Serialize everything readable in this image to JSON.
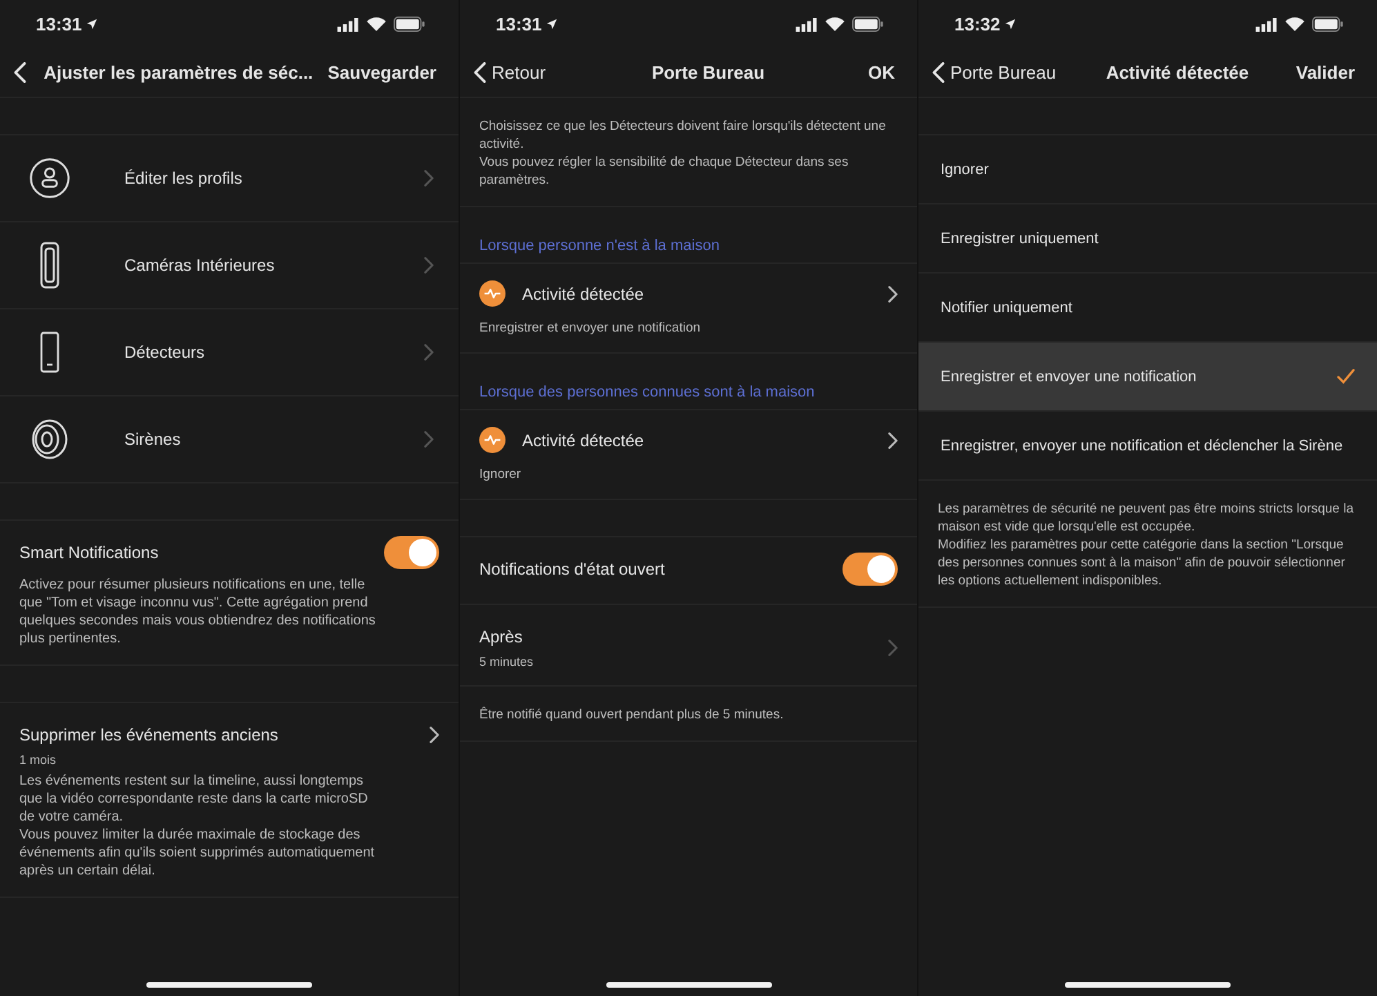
{
  "screens": [
    {
      "status_bar": {
        "time": "13:31"
      },
      "nav": {
        "title": "Ajuster les paramètres de séc...",
        "action": "Sauvegarder"
      },
      "blocks": [
        {
          "kind": "spacer"
        },
        {
          "kind": "menu",
          "items": [
            {
              "label": "Éditer les profils"
            },
            {
              "label": "Caméras Intérieures"
            },
            {
              "label": "Détecteurs"
            },
            {
              "label": "Sirènes"
            }
          ]
        },
        {
          "kind": "spacer"
        },
        {
          "kind": "toggle",
          "title": "Smart Notifications",
          "on": true,
          "description": "Activez pour résumer plusieurs notifications en une, telle que \"Tom et visage inconnu vus\". Cette agrégation prend quelques secondes mais vous obtiendrez des notifications plus pertinentes."
        },
        {
          "kind": "spacer"
        },
        {
          "kind": "link",
          "title": "Supprimer les événements anciens",
          "subtitle": "1 mois",
          "description": "Les événements restent sur la timeline, aussi longtemps que la vidéo correspondante reste dans la carte microSD de votre caméra.\nVous pouvez limiter la durée maximale de stockage des événements afin qu'ils soient supprimés automatiquement après un certain délai."
        }
      ]
    },
    {
      "status_bar": {
        "time": "13:31"
      },
      "nav": {
        "back_label": "Retour",
        "title": "Porte Bureau",
        "action": "OK"
      },
      "blocks": [
        {
          "kind": "note",
          "text": "Choisissez ce que les Détecteurs doivent faire lorsqu'ils détectent une activité.\nVous pouvez régler la sensibilité de chaque Détecteur dans ses paramètres."
        },
        {
          "kind": "header",
          "text": "Lorsque personne n'est à la maison"
        },
        {
          "kind": "activity",
          "title": "Activité détectée",
          "subtitle": "Enregistrer et envoyer une notification"
        },
        {
          "kind": "header",
          "text": "Lorsque des personnes connues sont à la maison"
        },
        {
          "kind": "activity",
          "title": "Activité détectée",
          "subtitle": "Ignorer"
        },
        {
          "kind": "spacer"
        },
        {
          "kind": "toggle",
          "title": "Notifications d'état ouvert",
          "on": true
        },
        {
          "kind": "link",
          "title": "Après",
          "subtitle": "5 minutes"
        },
        {
          "kind": "note",
          "text": "Être notifié quand ouvert pendant plus de 5 minutes."
        }
      ]
    },
    {
      "status_bar": {
        "time": "13:32"
      },
      "nav": {
        "back_label": "Porte Bureau",
        "title": "Activité détectée",
        "action": "Valider"
      },
      "blocks": [
        {
          "kind": "spacer"
        },
        {
          "kind": "options",
          "items": [
            {
              "label": "Ignorer",
              "selected": false
            },
            {
              "label": "Enregistrer uniquement",
              "selected": false
            },
            {
              "label": "Notifier uniquement",
              "selected": false
            },
            {
              "label": "Enregistrer et envoyer une notification",
              "selected": true
            },
            {
              "label": "Enregistrer, envoyer une notification et déclencher la Sirène",
              "selected": false
            }
          ]
        },
        {
          "kind": "note",
          "text": "Les paramètres de sécurité ne peuvent pas être moins stricts lorsque la maison est vide que lorsqu'elle est occupée.\nModifiez les paramètres pour cette catégorie dans la section \"Lorsque des personnes connues sont à la maison\" afin de pouvoir sélectionner les options actuellement indisponibles."
        }
      ]
    }
  ]
}
